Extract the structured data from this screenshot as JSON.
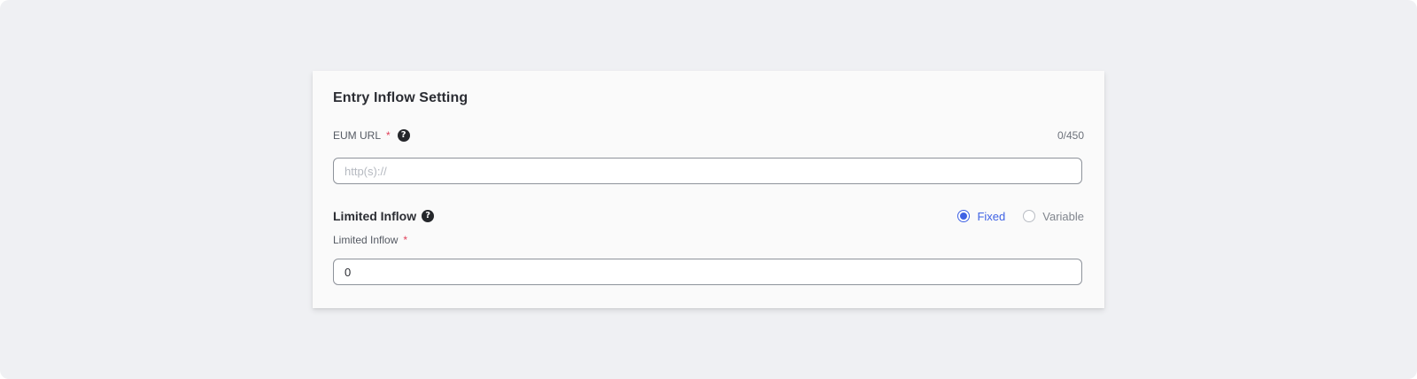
{
  "card": {
    "title": "Entry Inflow Setting"
  },
  "eum_url": {
    "label": "EUM URL",
    "required_mark": "*",
    "help_icon": "?",
    "counter": "0/450",
    "placeholder": "http(s)://",
    "value": ""
  },
  "limited_inflow_section": {
    "title": "Limited Inflow",
    "help_icon": "?",
    "mode_options": [
      {
        "label": "Fixed",
        "checked": true
      },
      {
        "label": "Variable",
        "checked": false
      }
    ]
  },
  "limited_inflow_field": {
    "label": "Limited Inflow",
    "required_mark": "*",
    "value": "0"
  },
  "colors": {
    "page_background": "#eff0f3",
    "card_background": "#fafafa",
    "accent": "#3f62e4",
    "required": "#e0405a"
  },
  "icons": {
    "help": "question-circle-icon",
    "radio_on": "radio-checked-icon",
    "radio_off": "radio-unchecked-icon"
  }
}
